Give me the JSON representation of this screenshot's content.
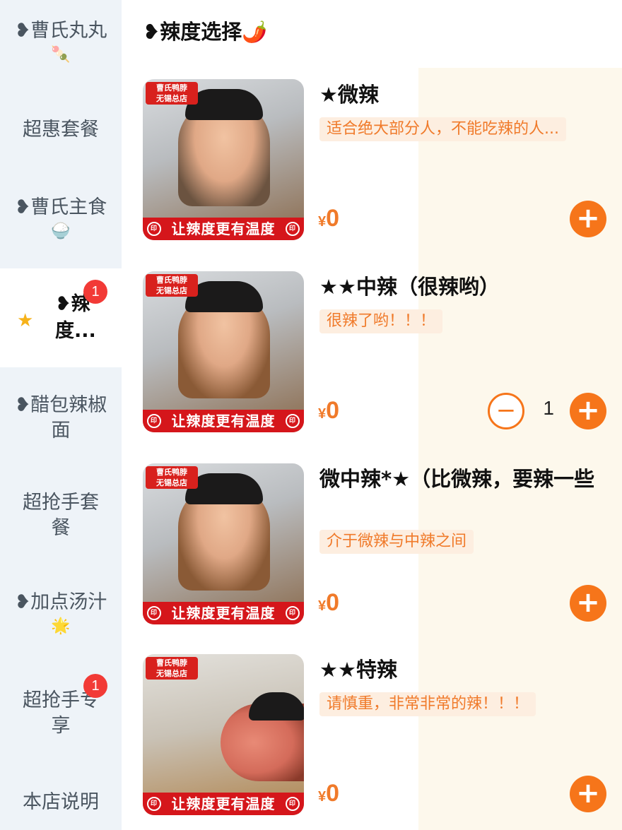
{
  "sidebar": {
    "items": [
      {
        "label": "❥曹氏丸丸",
        "emoji": "🍡"
      },
      {
        "label": "超惠套餐"
      },
      {
        "label": "❥曹氏主食",
        "emoji": "🍚"
      },
      {
        "label_line1": "❥辣",
        "label_line2": "度...",
        "badge": "1",
        "icon": "star-icon"
      },
      {
        "label_line1": "❥醋包辣椒",
        "label_line2": "面"
      },
      {
        "label_line1": "超抢手套",
        "label_line2": "餐"
      },
      {
        "label": "❥加点汤汁",
        "emoji": "🌟"
      },
      {
        "label_line1": "超抢手专",
        "label_line2": "享",
        "badge": "1"
      },
      {
        "label": "本店说明"
      }
    ]
  },
  "section": {
    "title": "❥辣度选择🌶️"
  },
  "thumb": {
    "logo_line1": "曹氏鸭脖",
    "logo_line2": "无锡总店",
    "banner": "让辣度更有温度",
    "seal": "印"
  },
  "products": [
    {
      "name": "★微辣",
      "desc": "适合绝大部分人，不能吃辣的人...",
      "currency": "¥",
      "price": "0"
    },
    {
      "name": "★★中辣（很辣哟）",
      "desc": "很辣了哟！！！",
      "currency": "¥",
      "price": "0",
      "quantity": "1"
    },
    {
      "name": "微中辣*★（比微辣，要辣一些",
      "desc": "介于微辣与中辣之间",
      "currency": "¥",
      "price": "0"
    },
    {
      "name": "★★特辣",
      "desc": "请慎重，非常非常的辣！！！",
      "currency": "¥",
      "price": "0"
    }
  ],
  "controls": {
    "add": "+",
    "minus": "−"
  },
  "colors": {
    "accent": "#f6751a",
    "badge": "#f23a36",
    "sidebar_bg": "#eef3f8",
    "content_bg": "#fdf8ec",
    "price": "#f07a2a"
  }
}
